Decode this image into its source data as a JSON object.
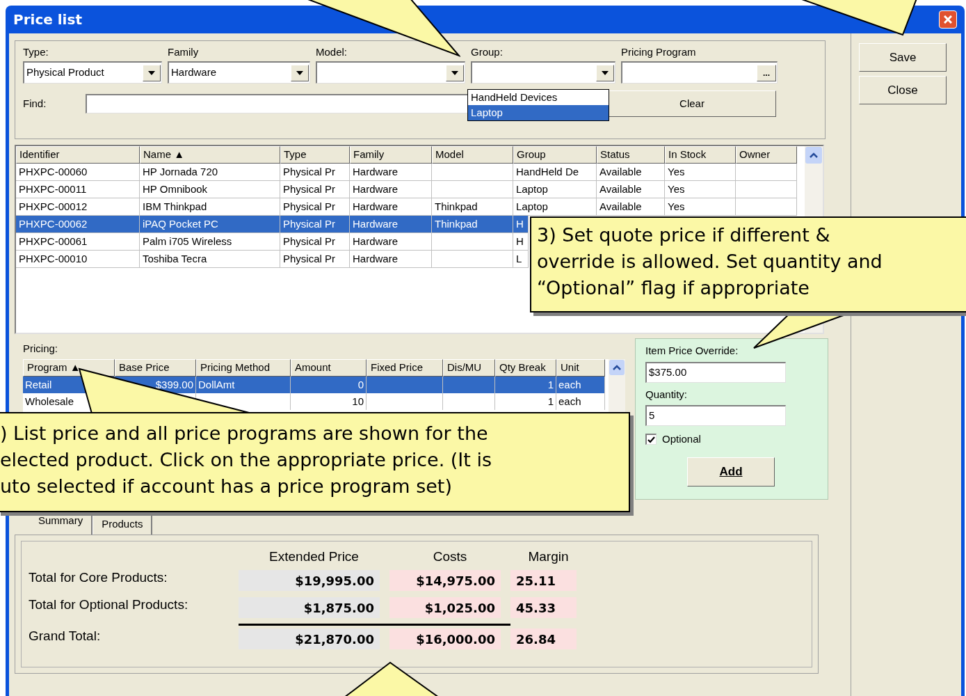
{
  "window": {
    "title": "Price list"
  },
  "filters": {
    "fields": [
      {
        "label": "Type:",
        "value": "Physical Product",
        "kind": "combo"
      },
      {
        "label": "Family",
        "value": "Hardware",
        "kind": "combo"
      },
      {
        "label": "Model:",
        "kind": "combo"
      },
      {
        "label": "Group:",
        "kind": "combo"
      },
      {
        "label": "Pricing Program",
        "kind": "picker",
        "button": "..."
      }
    ],
    "group_options": [
      {
        "label": "HandHeld Devices",
        "selected": false
      },
      {
        "label": "Laptop",
        "selected": true
      }
    ],
    "find_label": "Find:",
    "clear_button": "Clear"
  },
  "side_buttons": [
    "Save",
    "Close"
  ],
  "products": {
    "columns": [
      "Identifier",
      "Name ▲",
      "Type",
      "Family",
      "Model",
      "Group",
      "Status",
      "In Stock",
      "Owner"
    ],
    "rows": [
      {
        "selected": false,
        "cells": [
          "PHXPC-00060",
          "HP Jornada 720",
          "Physical Pr",
          "Hardware",
          "",
          "HandHeld De",
          "Available",
          "Yes"
        ]
      },
      {
        "selected": false,
        "cells": [
          "PHXPC-00011",
          "HP Omnibook",
          "Physical Pr",
          "Hardware",
          "",
          "Laptop",
          "Available",
          "Yes"
        ]
      },
      {
        "selected": false,
        "cells": [
          "PHXPC-00012",
          "IBM Thinkpad",
          "Physical Pr",
          "Hardware",
          "Thinkpad",
          "Laptop",
          "Available",
          "Yes"
        ]
      },
      {
        "selected": true,
        "cells": [
          "PHXPC-00062",
          "iPAQ Pocket PC",
          "Physical Pr",
          "Hardware",
          "Thinkpad",
          "H"
        ]
      },
      {
        "selected": false,
        "cells": [
          "PHXPC-00061",
          "Palm i705 Wireless",
          "Physical Pr",
          "Hardware",
          "",
          "H"
        ]
      },
      {
        "selected": false,
        "cells": [
          "PHXPC-00010",
          "Toshiba Tecra",
          "Physical Pr",
          "Hardware",
          "",
          "L"
        ]
      }
    ]
  },
  "pricing": {
    "label": "Pricing:",
    "columns": [
      "Program ▲",
      "Base Price",
      "Pricing Method",
      "Amount",
      "Fixed Price",
      "Dis/MU",
      "Qty Break",
      "Unit"
    ],
    "rows": [
      {
        "selected": true,
        "cells": [
          "Retail",
          "$399.00",
          "DollAmt",
          "0",
          "",
          "",
          "1",
          "each"
        ]
      },
      {
        "selected": false,
        "cells": [
          "Wholesale",
          "",
          "",
          "10",
          "",
          "",
          "1",
          "each"
        ]
      }
    ]
  },
  "override": {
    "price_label": "Item Price Override:",
    "price": "$375.00",
    "quantity_label": "Quantity:",
    "quantity": "5",
    "optional": {
      "label": "Optional",
      "checked": true
    },
    "add_button": "Add"
  },
  "tabs": [
    {
      "label": "Summary",
      "selected": true
    },
    {
      "label": "Products",
      "selected": false
    }
  ],
  "summary": {
    "columns": [
      "Extended Price",
      "Costs",
      "Margin"
    ],
    "rows": [
      {
        "label": "Total for Core Products:",
        "total": false,
        "values": [
          "$19,995.00",
          "$14,975.00",
          "25.11"
        ]
      },
      {
        "label": "Total for Optional Products:",
        "total": false,
        "values": [
          "$1,875.00",
          "$1,025.00",
          "45.33"
        ]
      },
      {
        "label": "Grand Total:",
        "total": true,
        "values": [
          "$21,870.00",
          "$16,000.00",
          "26.84"
        ]
      }
    ]
  },
  "callouts": [
    {
      "lines": [
        "3) Set quote price if different &",
        "override is allowed. Set quantity and",
        "“Optional” flag if appropriate"
      ]
    },
    {
      "lines": [
        ") List price and all price programs are shown for the",
        "elected product. Click on the appropriate price. (It is",
        "uto selected if account has a price program set)"
      ]
    }
  ]
}
